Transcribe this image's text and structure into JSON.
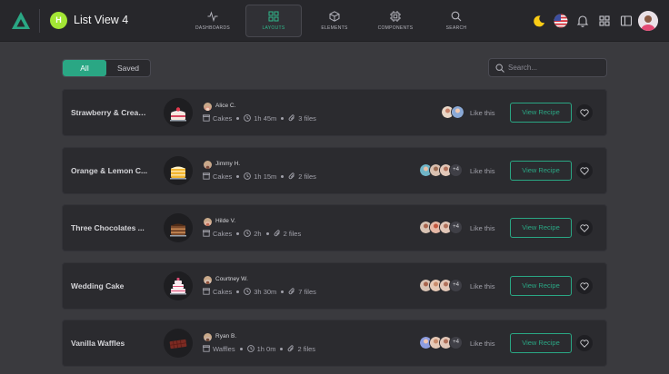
{
  "app": {
    "avatar_letter": "H",
    "title": "List View 4"
  },
  "nav": [
    {
      "label": "DASHBOARDS",
      "icon": "activity-icon"
    },
    {
      "label": "LAYOUTS",
      "icon": "grid-icon",
      "active": true
    },
    {
      "label": "ELEMENTS",
      "icon": "cube-icon"
    },
    {
      "label": "COMPONENTS",
      "icon": "cpu-icon"
    },
    {
      "label": "SEARCH",
      "icon": "search-icon"
    }
  ],
  "toolbar": {
    "all_label": "All",
    "saved_label": "Saved",
    "search_placeholder": "Search..."
  },
  "colors": {
    "accent": "#2aa784",
    "background": "#3a3a3e",
    "card": "#2b2b2f",
    "topbar": "#27272b"
  },
  "recipes": [
    {
      "title": "Strawberry & Cream...",
      "author": "Alice C.",
      "category": "Cakes",
      "time": "1h 45m",
      "files": "3 files",
      "likes_more": "",
      "like_label": "Like this",
      "button": "View Recipe",
      "thumb": "strawberry-cake"
    },
    {
      "title": "Orange & Lemon C...",
      "author": "Jimmy H.",
      "category": "Cakes",
      "time": "1h 15m",
      "files": "2 files",
      "likes_more": "+4",
      "like_label": "Like this",
      "button": "View Recipe",
      "thumb": "orange-cake"
    },
    {
      "title": "Three Chocolates ...",
      "author": "Hilde V.",
      "category": "Cakes",
      "time": "2h",
      "files": "2 files",
      "likes_more": "+4",
      "like_label": "Like this",
      "button": "View Recipe",
      "thumb": "chocolate-cake"
    },
    {
      "title": "Wedding Cake",
      "author": "Courtney W.",
      "category": "Cakes",
      "time": "3h 30m",
      "files": "7 files",
      "likes_more": "+4",
      "like_label": "Like this",
      "button": "View Recipe",
      "thumb": "wedding-cake"
    },
    {
      "title": "Vanilla Waffles",
      "author": "Ryan B.",
      "category": "Waffles",
      "time": "1h 0m",
      "files": "2 files",
      "likes_more": "+4",
      "like_label": "Like this",
      "button": "View Recipe",
      "thumb": "waffles"
    }
  ]
}
